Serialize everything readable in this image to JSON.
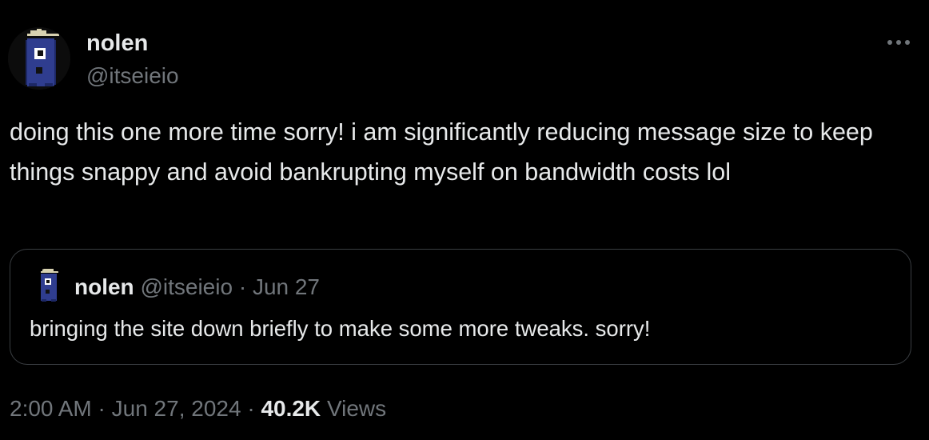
{
  "author": {
    "name": "nolen",
    "handle": "@itseieio",
    "avatar_icon": "pixel-robot-avatar-icon"
  },
  "more_icon": "more-horizontal-icon",
  "tweet": {
    "text": "doing this one more time sorry! i am significantly reducing message size to keep things snappy and avoid bankrupting myself on bandwidth costs lol"
  },
  "quote": {
    "name": "nolen",
    "handle": "@itseieio",
    "separator": "·",
    "date": "Jun 27",
    "text": "bringing the site down briefly to make some more tweaks. sorry!"
  },
  "meta": {
    "time": "2:00 AM",
    "separator1": "·",
    "date": "Jun 27, 2024",
    "separator2": "·",
    "views_count": "40.2K",
    "views_label": "Views"
  },
  "colors": {
    "background": "#000000",
    "text_primary": "#e7e9ea",
    "text_secondary": "#71767b",
    "border": "#3a3e42",
    "avatar_blue": "#2f3d8f"
  }
}
